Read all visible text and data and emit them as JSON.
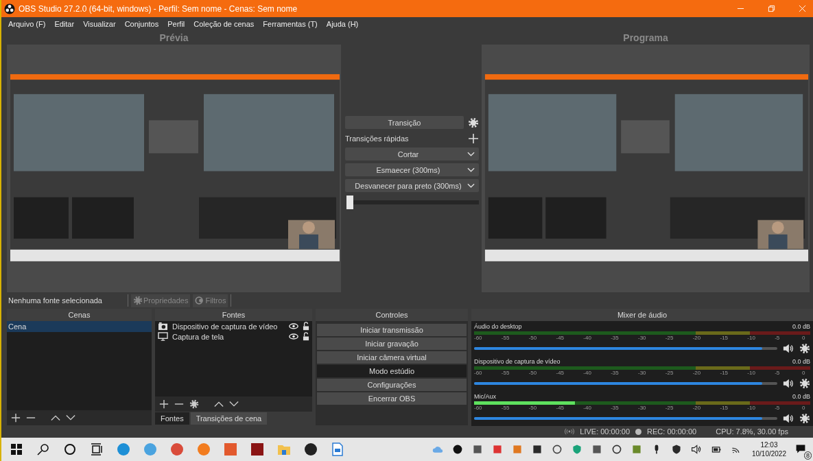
{
  "window": {
    "title": "OBS Studio 27.2.0 (64-bit, windows) - Perfil: Sem nome - Cenas: Sem nome"
  },
  "menu": [
    "Arquivo (F)",
    "Editar",
    "Visualizar",
    "Conjuntos",
    "Perfil",
    "Coleção de cenas",
    "Ferramentas (T)",
    "Ajuda (H)"
  ],
  "preview": {
    "label": "Prévia",
    "kind": "picture"
  },
  "program": {
    "label": "Programa",
    "kind": "picture"
  },
  "transitions": {
    "button": "Transição",
    "quick_label": "Transições rápidas",
    "items": [
      "Cortar",
      "Esmaecer (300ms)",
      "Desvanecer para preto (300ms)"
    ],
    "tbar": {
      "level": 0
    }
  },
  "source_toolbar": {
    "status": "Nenhuma fonte selecionada",
    "buttons": [
      {
        "label": "Propriedades",
        "kind": "gear",
        "disabled": true
      },
      {
        "label": "Filtros",
        "kind": "filter",
        "disabled": true
      }
    ]
  },
  "scenes": {
    "title": "Cenas",
    "items": [
      {
        "label": "Cena",
        "selected": true
      }
    ]
  },
  "sources": {
    "title": "Fontes",
    "items": [
      {
        "label": "Dispositivo de captura de vídeo",
        "kind": "camera",
        "visible": true,
        "locked": false
      },
      {
        "label": "Captura de tela",
        "kind": "monitor",
        "visible": true,
        "locked": false
      }
    ],
    "tabs": [
      {
        "label": "Fontes",
        "selected": true
      },
      {
        "label": "Transições de cena",
        "selected": false
      }
    ]
  },
  "controls": {
    "title": "Controles",
    "buttons": [
      {
        "label": "Iniciar transmissão",
        "active": false
      },
      {
        "label": "Iniciar gravação",
        "active": false
      },
      {
        "label": "Iniciar câmera virtual",
        "active": false
      },
      {
        "label": "Modo estúdio",
        "active": true
      },
      {
        "label": "Configurações",
        "active": false
      },
      {
        "label": "Encerrar OBS",
        "active": false
      }
    ]
  },
  "mixer": {
    "title": "Mixer de áudio",
    "channels": [
      {
        "name": "Áudio do desktop",
        "reading": "0.0 dB",
        "volume": {
          "level": 0.95
        },
        "muted": false,
        "ticks": [
          "-60",
          "-55",
          "-50",
          "-45",
          "-40",
          "-35",
          "-30",
          "-25",
          "-20",
          "-15",
          "-10",
          "-5",
          "0"
        ]
      },
      {
        "name": "Dispositivo de captura de vídeo",
        "reading": "0.0 dB",
        "volume": {
          "level": 0.95
        },
        "muted": false,
        "ticks": [
          "-60",
          "-55",
          "-50",
          "-45",
          "-40",
          "-35",
          "-30",
          "-25",
          "-20",
          "-15",
          "-10",
          "-5",
          "0"
        ]
      },
      {
        "name": "Mic/Aux",
        "reading": "0.0 dB",
        "meter": {
          "level": 0.3
        },
        "volume": {
          "level": 0.95
        },
        "muted": false,
        "ticks": [
          "-60",
          "-55",
          "-50",
          "-45",
          "-40",
          "-35",
          "-30",
          "-25",
          "-20",
          "-15",
          "-10",
          "-5",
          "0"
        ]
      }
    ]
  },
  "status_bar": {
    "live": "LIVE: 00:00:00",
    "rec": "REC: 00:00:00",
    "cpu": "CPU: 7.8%, 30.00 fps"
  },
  "taskbar": {
    "time": "12:03",
    "date": "10/10/2022",
    "notifications": "8"
  }
}
